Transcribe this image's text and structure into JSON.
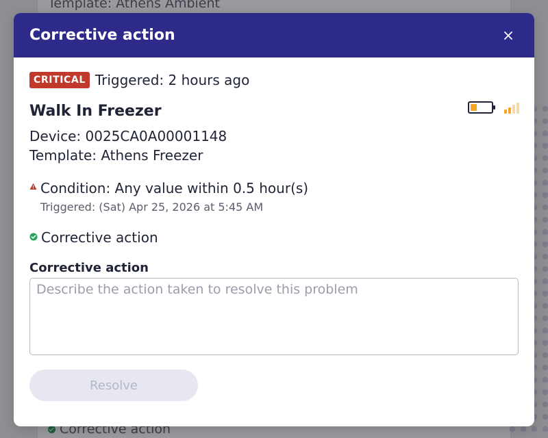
{
  "background": {
    "top_text": "Template: Athens Ambient",
    "bottom_text": "Corrective action"
  },
  "modal": {
    "title": "Corrective action",
    "close_icon": "close-icon",
    "severity_badge": "CRITICAL",
    "triggered_relative": "Triggered: 2 hours ago",
    "device_name": "Walk In Freezer",
    "device_id": "Device: 0025CA0A00001148",
    "template": "Template: Athens Freezer",
    "battery_level": 0.3,
    "signal_bars_active": 2,
    "signal_bars_total": 4,
    "condition": "Condition: Any value within 0.5 hour(s)",
    "condition_triggered": "Triggered: (Sat) Apr 25, 2026 at 5:45 AM",
    "corrective_status": "Corrective action",
    "field_label": "Corrective action",
    "field_placeholder": "Describe the action taken to resolve this problem",
    "field_value": "",
    "resolve_label": "Resolve"
  },
  "colors": {
    "header": "#2e2a8a",
    "critical": "#c0392b",
    "ok": "#27a35a",
    "battery": "#f5a623",
    "signal_active": "#f5a623",
    "signal_inactive": "#f6d9a8"
  }
}
